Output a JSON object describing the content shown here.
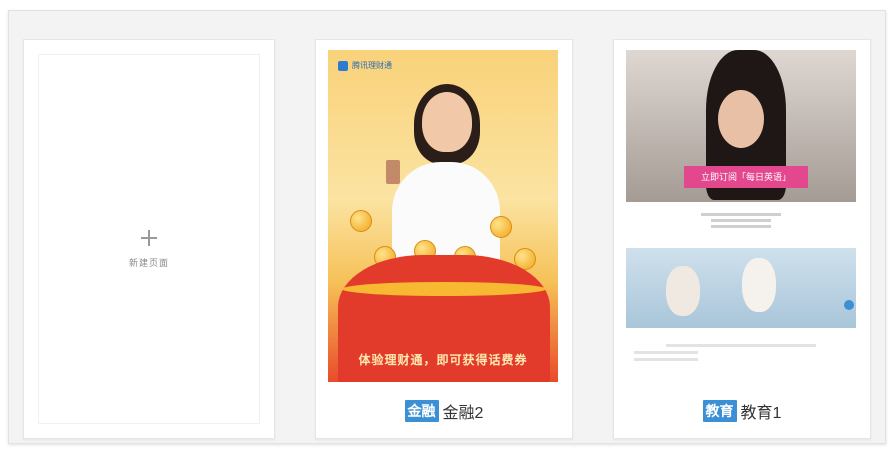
{
  "new_page": {
    "label": "新建页面",
    "icon": "plus-icon"
  },
  "templates": [
    {
      "tag": "金融",
      "title": "金融2",
      "poster": {
        "brand": "腾讯理财通",
        "slogan": "体验理财通，即可获得话费券"
      },
      "accent": "#3b8fd4"
    },
    {
      "tag": "教育",
      "title": "教育1",
      "poster": {
        "banner": "立即订阅「每日英语」"
      },
      "accent": "#3b8fd4"
    }
  ]
}
